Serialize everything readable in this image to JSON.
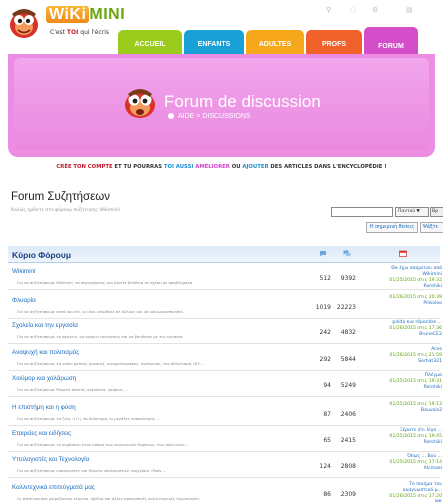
{
  "header": {
    "logo_wiki": "WiKi",
    "logo_mini": "MINI",
    "tagline_prefix": "C'est ",
    "tagline_toi": "TOI",
    "tagline_suffix": " qui l'écris"
  },
  "nav": {
    "accueil": "ACCUEIL",
    "enfants": "ENFANTS",
    "adultes": "ADULTES",
    "profs": "PROFS",
    "forum": "FORUM"
  },
  "banner": {
    "title": "Forum de discussion",
    "crumb": "AIDE > DISCUSSIONS"
  },
  "promo": {
    "p1": "CRÉE TON COMPTE",
    "p2": " ET TU POURRAS ",
    "p3": "TOI AUSSI",
    "p4": " AMÉLIORER",
    "p5": " OU ",
    "p6": "AJOUTER",
    "p7": " DES ARTICLES DANS L'ENCYCLOPÉDIE !"
  },
  "forum": {
    "title": "Forum Συζητήσεων",
    "subtitle": "Καλώς ήρθατε στο φόρουμ συζήτησης Wikimini!",
    "search_placeholder": "",
    "search_select": "Παντού ▼",
    "search_go": "Βρ",
    "today_button": "Η σημερινή θέσεις",
    "search_button": "Ψάξτε"
  },
  "table": {
    "header_title": "Κύριο Φόρουμ",
    "rows": [
      {
        "name": "Wikimini",
        "desc": "Για να συζητήσουμε Wikimini, τα περιεχόμενα, και βρείτε βοήθεια σε σχέση με προβλήματα.",
        "topics": "512",
        "posts": "9392",
        "last_title": "Θα έχω απομείνει από",
        "last_title2": "Wikimini",
        "last_date": "01/25/2015 στις 19:32",
        "last_user": "Rorohiki"
      },
      {
        "name": "Φλυαρία",
        "desc": "Για να συζητήσουμε αυτό και ότι, οι ίδιοι ειπώθηκε σε άλλους και να κοινωνικοποιηθεί.",
        "topics": "1019",
        "posts": "22223",
        "last_title": "",
        "last_title2": "",
        "last_date": "01/26/2015 στις 20:39",
        "last_user": "Pillsoloo"
      },
      {
        "name": "Σχολείο και την εργασία",
        "desc": "Για να συζητήσουμε το σχολείο, να κάνουν ερωτήσεις και να βοηθήσει με την εργασία.",
        "topics": "242",
        "posts": "4832",
        "last_title": "polda κια répondre ...",
        "last_title2": "",
        "last_date": "01/26/2015 στις 17:36",
        "last_user": "BruneCE2"
      },
      {
        "name": "Αναψυχή και πολιτισμός",
        "desc": "Για να συζητήσουμε τα video games, μουσική, κινηματογράφος, ανάγνωση, τον αθλητισμό, DIY ...",
        "topics": "292",
        "posts": "5844",
        "last_title": "Aces",
        "last_title2": "",
        "last_date": "01/26/2015 στις 21:59",
        "last_user": "Serhat321"
      },
      {
        "name": "Χιούμορ και χαλάρωση",
        "desc": "Για να συζητήσουμε θέματα αστεία, ανέκδοτα, γρίφους ...",
        "topics": "94",
        "posts": "5249",
        "last_title": "Πλέγμα",
        "last_title2": "",
        "last_date": "01/25/2015 στις 19:31",
        "last_user": "Rorohiki"
      },
      {
        "name": "Η επιστήμη και η φύση",
        "desc": "Για να συζητήσουμε τα ζώα, η Γη, το διάστημα, οι μεγάλες ανακαλύψεις ...",
        "topics": "87",
        "posts": "2406",
        "last_title": "",
        "last_title2": "",
        "last_date": "01/25/2015 στις 19:13",
        "last_user": "Bauvois2"
      },
      {
        "name": "Εταιρείες και ειδήσεις",
        "desc": "Για να συζητήσουμε το συμβαίνει στον κόσμο των κοινωνικών θεμάτων, των πολιτικών ...",
        "topics": "65",
        "posts": "2415",
        "last_title": "Ξέρατε ότι λίγο ...",
        "last_title2": "",
        "last_date": "01/25/2015 στις 19:45",
        "last_user": "Rorohiki"
      },
      {
        "name": "Υπολογιστές και Τεχνολογία",
        "desc": "Για να συζητήσουμε υπολογιστές και θέματα υπολογιστών, παιχνίδια, iPods ...",
        "topics": "124",
        "posts": "2808",
        "last_title": "Όπως ... Βου ...",
        "last_title2": "",
        "last_date": "01/25/2015 στις 17:14",
        "last_user": "Alcmaei"
      },
      {
        "name": "Καλλιτεχνικά επιτεύγματά μας",
        "desc": "Οι wikiminautes μοιράζονται κείμενα, σχέδια και άλλες προσωπικές καλλιτεχνικές δημιουργίες.",
        "topics": "86",
        "posts": "2309",
        "last_title": "Το ποιήμα του",
        "last_title2": "αναγνωστικό μ...",
        "last_date": "01/26/2015 στις 17:20",
        "last_user": "MR"
      }
    ]
  },
  "colors": {
    "accueil": "#9bcb1d",
    "enfants": "#19a0d7",
    "adultes": "#f7a81a",
    "profs": "#f1622a",
    "forum": "#d34ec8",
    "link": "#1d6dbf",
    "date": "#5aa400"
  }
}
